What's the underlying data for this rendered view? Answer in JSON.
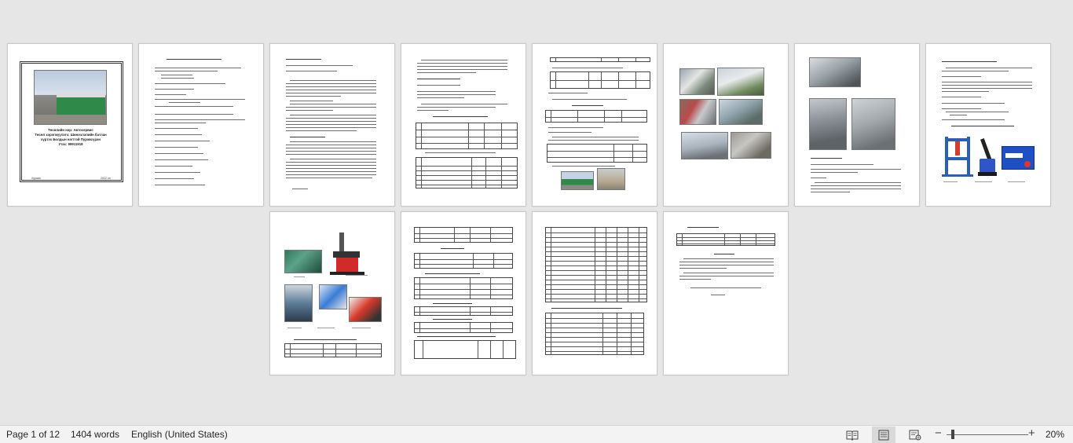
{
  "document": {
    "cover": {
      "title_lines": [
        "Төсөлийн нэр: Автосервис",
        "Төсөл хэрэгжүүлэгч: Шинэчлэлийн батлан",
        "хүртэх Болдын нэгтгэй Пүрэвсүрэн",
        "Утас: 99911918"
      ],
      "footer_left": "Хураан",
      "footer_right": "2022 он"
    }
  },
  "status_bar": {
    "page_info": "Page 1 of 12",
    "word_count": "1404 words",
    "language": "English (United States)",
    "zoom_level": "20%",
    "views": [
      "read-mode-icon",
      "print-layout-icon",
      "web-layout-icon"
    ]
  },
  "colors": {
    "workspace": "#e6e6e6",
    "page": "#ffffff",
    "status_bar": "#f3f3f3",
    "building_green": "#2f8a4a"
  }
}
